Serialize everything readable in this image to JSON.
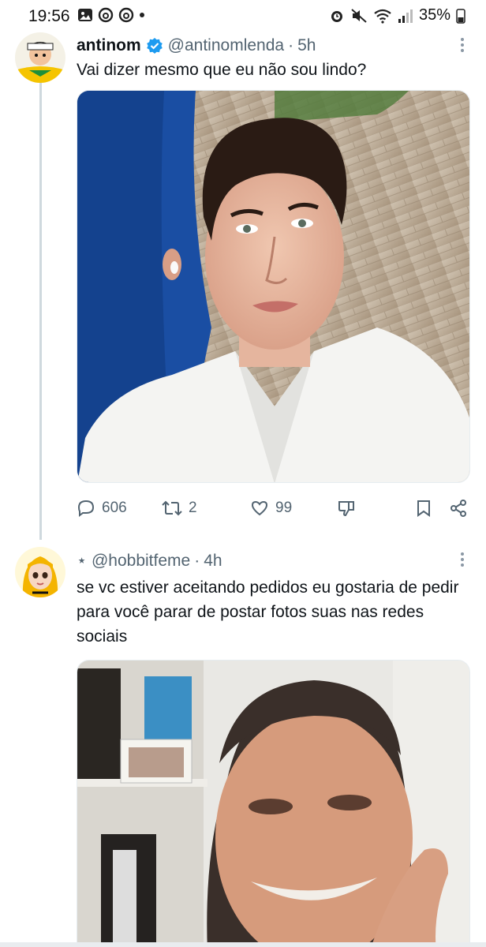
{
  "status_bar": {
    "time": "19:56",
    "battery": "35%"
  },
  "tweets": [
    {
      "name": "antinom",
      "handle": "@antinomlenda",
      "time": "5h",
      "text": "Vai dizer mesmo que eu não sou lindo?",
      "replies": "606",
      "retweets": "2",
      "likes": "99"
    },
    {
      "name": "",
      "handle": "⋆ @hobbitfeme",
      "time": "4h",
      "text": "se vc estiver aceitando pedidos eu gostaria de pedir para você parar de postar fotos suas nas redes sociais"
    }
  ],
  "colors": {
    "verified": "#1d9bf0",
    "secondary_text": "#536471",
    "thread_line": "#cfd9de"
  },
  "icons": {
    "reply": "reply-icon",
    "retweet": "retweet-icon",
    "like": "heart-icon",
    "dislike": "dislike-icon",
    "bookmark": "bookmark-icon",
    "share": "share-icon"
  }
}
